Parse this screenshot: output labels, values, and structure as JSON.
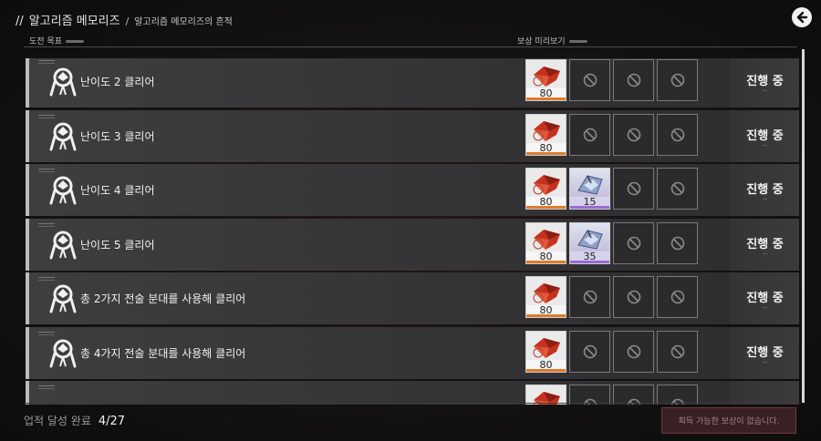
{
  "header": {
    "breadcrumb_prefix": "//",
    "breadcrumb_main": "알고리즘 메모리즈",
    "breadcrumb_sep": "/",
    "breadcrumb_sub": "알고리즘 메모리즈의 흔적"
  },
  "columns": {
    "challenge": "도전 목표",
    "reward_preview": "보상 미리보기"
  },
  "rows": [
    {
      "title": "난이도 2 클리어",
      "status": "진행 중",
      "rewards": [
        {
          "qty": "80",
          "rarity": "orange"
        }
      ]
    },
    {
      "title": "난이도 3 클리어",
      "status": "진행 중",
      "rewards": [
        {
          "qty": "80",
          "rarity": "orange"
        }
      ]
    },
    {
      "title": "난이도 4 클리어",
      "status": "진행 중",
      "rewards": [
        {
          "qty": "80",
          "rarity": "orange"
        },
        {
          "qty": "15",
          "rarity": "purple"
        }
      ]
    },
    {
      "title": "난이도 5 클리어",
      "status": "진행 중",
      "rewards": [
        {
          "qty": "80",
          "rarity": "orange"
        },
        {
          "qty": "35",
          "rarity": "purple"
        }
      ]
    },
    {
      "title": "총 2가지 전술 분대를 사용해 클리어",
      "status": "진행 중",
      "rewards": [
        {
          "qty": "80",
          "rarity": "orange"
        }
      ]
    },
    {
      "title": "총 4가지 전술 분대를 사용해 클리어",
      "status": "진행 중",
      "rewards": [
        {
          "qty": "80",
          "rarity": "orange"
        }
      ]
    }
  ],
  "footer": {
    "achievement_label": "업적 달성 완료",
    "achievement_value": "4/27",
    "claim_button": "획득 가능한 보상이 없습니다."
  },
  "colors": {
    "orange": "#e07a2a",
    "purple": "#9a6ad6",
    "accent_red": "#6e3a3e"
  }
}
